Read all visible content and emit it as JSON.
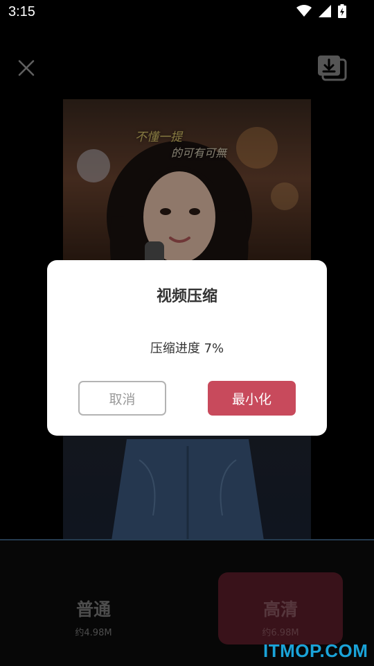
{
  "status_bar": {
    "time": "3:15",
    "icons": [
      "wifi-icon",
      "cell-signal-icon",
      "battery-charging-icon"
    ]
  },
  "toolbar": {
    "close_icon": "close-icon",
    "save_icon": "save-download-icon"
  },
  "video": {
    "lyric_line_1": "不懂一提",
    "lyric_line_2": "的可有可無"
  },
  "quality_options": [
    {
      "name": "普通",
      "size": "约4.98M",
      "selected": false
    },
    {
      "name": "高清",
      "size": "约6.98M",
      "selected": true
    }
  ],
  "dialog": {
    "title": "视频压缩",
    "progress_text": "压缩进度 7%",
    "progress_percent": 7,
    "cancel_label": "取消",
    "minimize_label": "最小化"
  },
  "watermark": "ITMOP.COM",
  "colors": {
    "accent": "#c84a5c",
    "selected_option_bg": "#5d1e2a",
    "progress_line": "#3d5f80"
  }
}
